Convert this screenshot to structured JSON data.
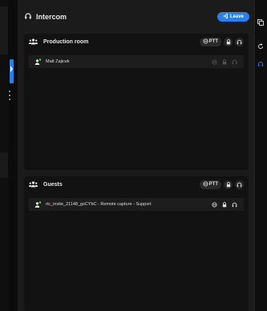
{
  "header": {
    "title": "Intercom",
    "leave_label": "Leave"
  },
  "production_room": {
    "title": "Production room",
    "ptt_label": "PTT",
    "members": [
      {
        "name": "Matt Zajicek"
      }
    ]
  },
  "guests": {
    "title": "Guests",
    "ptt_label": "PTT",
    "members": [
      {
        "name": "rtc_invite_21148_gsCYbC - Remote capture - Support"
      }
    ]
  },
  "colors": {
    "accent": "#2b7fe8",
    "online": "#3ccf4e"
  },
  "icons": [
    "headset-icon",
    "users-icon",
    "lock-icon",
    "exit-icon",
    "user-online-icon",
    "copy-icon",
    "refresh-icon"
  ]
}
